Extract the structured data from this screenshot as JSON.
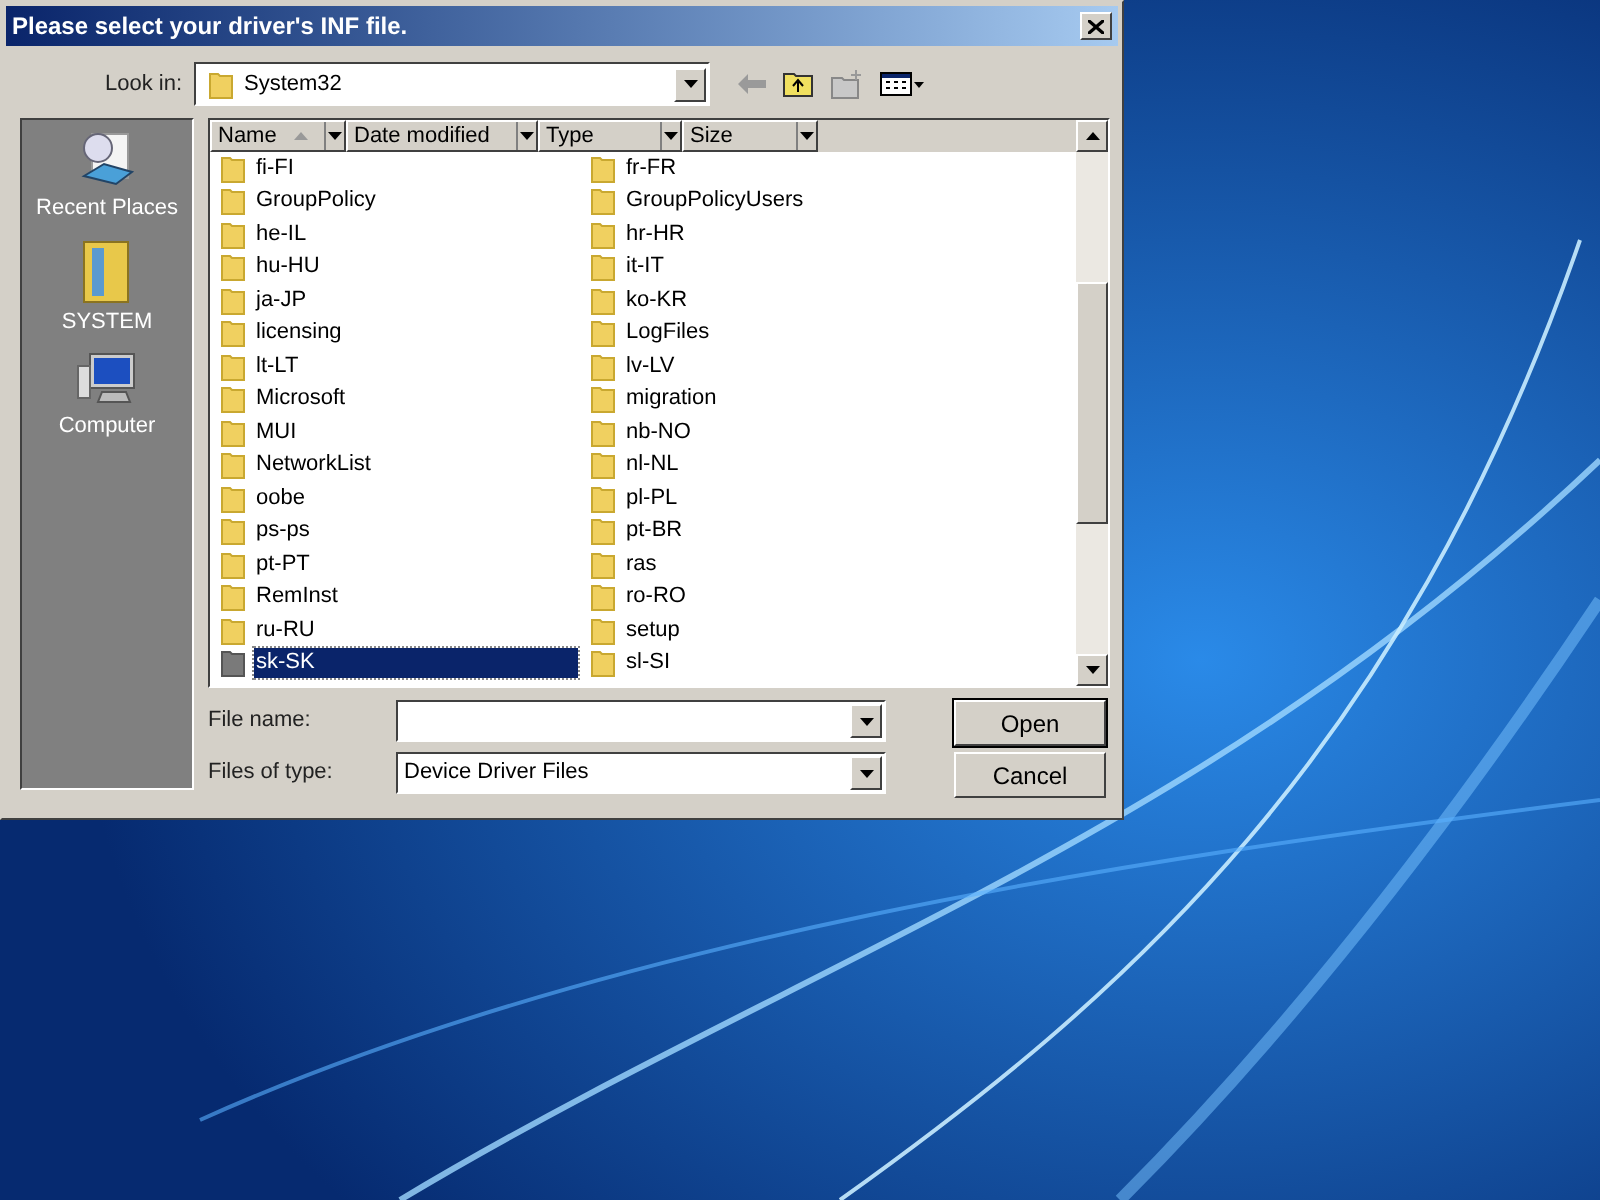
{
  "dialog": {
    "title": "Please select your driver's INF file.",
    "look_in": {
      "label": "Look in:",
      "value": "System32"
    },
    "places": [
      {
        "kind": "recent",
        "label": "Recent Places"
      },
      {
        "kind": "user",
        "label": "SYSTEM"
      },
      {
        "kind": "computer",
        "label": "Computer"
      }
    ],
    "columns": [
      "Name",
      "Date modified",
      "Type",
      "Size"
    ],
    "items": [
      {
        "name": "fi-FI",
        "selected": false
      },
      {
        "name": "GroupPolicy",
        "selected": false
      },
      {
        "name": "he-IL",
        "selected": false
      },
      {
        "name": "hu-HU",
        "selected": false
      },
      {
        "name": "ja-JP",
        "selected": false
      },
      {
        "name": "licensing",
        "selected": false
      },
      {
        "name": "lt-LT",
        "selected": false
      },
      {
        "name": "Microsoft",
        "selected": false
      },
      {
        "name": "MUI",
        "selected": false
      },
      {
        "name": "NetworkList",
        "selected": false
      },
      {
        "name": "oobe",
        "selected": false
      },
      {
        "name": "ps-ps",
        "selected": false
      },
      {
        "name": "pt-PT",
        "selected": false
      },
      {
        "name": "RemInst",
        "selected": false
      },
      {
        "name": "ru-RU",
        "selected": false
      },
      {
        "name": "sk-SK",
        "selected": true
      },
      {
        "name": "fr-FR",
        "selected": false
      },
      {
        "name": "GroupPolicyUsers",
        "selected": false
      },
      {
        "name": "hr-HR",
        "selected": false
      },
      {
        "name": "it-IT",
        "selected": false
      },
      {
        "name": "ko-KR",
        "selected": false
      },
      {
        "name": "LogFiles",
        "selected": false
      },
      {
        "name": "lv-LV",
        "selected": false
      },
      {
        "name": "migration",
        "selected": false
      },
      {
        "name": "nb-NO",
        "selected": false
      },
      {
        "name": "nl-NL",
        "selected": false
      },
      {
        "name": "pl-PL",
        "selected": false
      },
      {
        "name": "pt-BR",
        "selected": false
      },
      {
        "name": "ras",
        "selected": false
      },
      {
        "name": "ro-RO",
        "selected": false
      },
      {
        "name": "setup",
        "selected": false
      },
      {
        "name": "sl-SI",
        "selected": false
      }
    ],
    "file_name": {
      "label": "File name:"
    },
    "file_type": {
      "label": "Files of type:",
      "value": "Device Driver Files"
    },
    "buttons": [
      "Open",
      "Cancel"
    ]
  }
}
